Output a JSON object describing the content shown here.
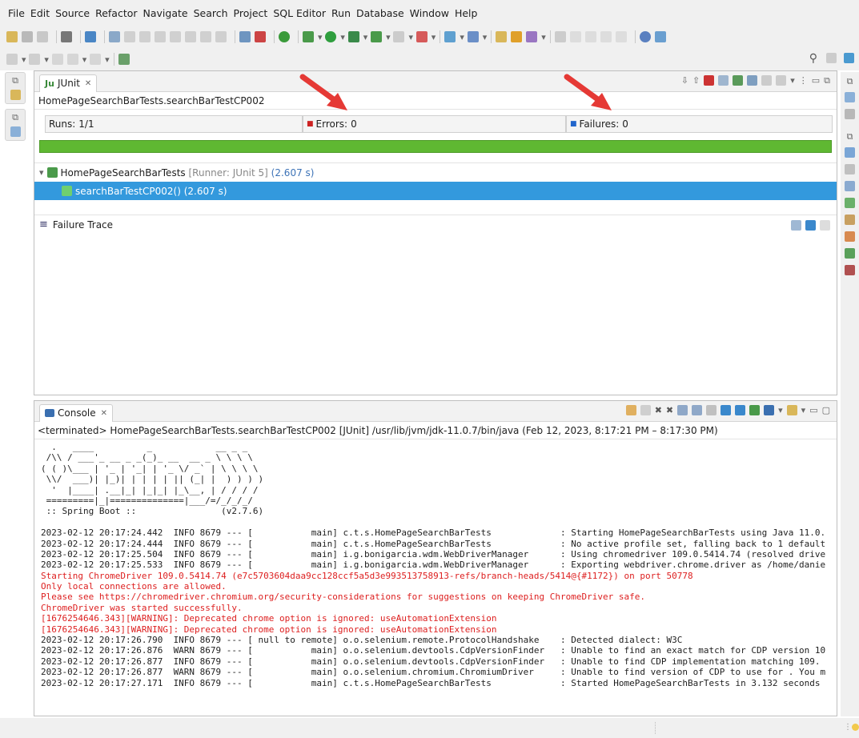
{
  "menu": [
    "File",
    "Edit",
    "Source",
    "Refactor",
    "Navigate",
    "Search",
    "Project",
    "SQL Editor",
    "Run",
    "Database",
    "Window",
    "Help"
  ],
  "junit": {
    "tab_label": "JUnit",
    "test_name": "HomePageSearchBarTests.searchBarTestCP002",
    "runs_label": "Runs:",
    "runs_value": "1/1",
    "errors_label": "Errors:",
    "errors_value": "0",
    "failures_label": "Failures:",
    "failures_value": "0",
    "progress_status_color": "#5fb832",
    "tree_root_name": "HomePageSearchBarTests",
    "tree_root_runner": "[Runner: JUnit 5]",
    "tree_root_time": "(2.607 s)",
    "tree_child_name": "searchBarTestCP002()",
    "tree_child_time": "(2.607 s)",
    "failure_trace_label": "Failure Trace"
  },
  "console": {
    "tab_label": "Console",
    "header": "<terminated> HomePageSearchBarTests.searchBarTestCP002 [JUnit] /usr/lib/jvm/jdk-11.0.7/bin/java (Feb 12, 2023, 8:17:21 PM – 8:17:30 PM)",
    "lines": [
      {
        "t": "  .   ____          _            __ _ _",
        "c": "normal"
      },
      {
        "t": " /\\\\ / ___'_ __ _ _(_)_ __  __ _ \\ \\ \\ \\",
        "c": "normal"
      },
      {
        "t": "( ( )\\___ | '_ | '_| | '_ \\/ _` | \\ \\ \\ \\",
        "c": "normal"
      },
      {
        "t": " \\\\/  ___)| |_)| | | | | || (_| |  ) ) ) )",
        "c": "normal"
      },
      {
        "t": "  '  |____| .__|_| |_|_| |_\\__, | / / / /",
        "c": "normal"
      },
      {
        "t": " =========|_|==============|___/=/_/_/_/",
        "c": "normal"
      },
      {
        "t": " :: Spring Boot ::                (v2.7.6)",
        "c": "normal"
      },
      {
        "t": "",
        "c": "normal"
      },
      {
        "t": "2023-02-12 20:17:24.442  INFO 8679 --- [           main] c.t.s.HomePageSearchBarTests             : Starting HomePageSearchBarTests using Java 11.0.",
        "c": "normal"
      },
      {
        "t": "2023-02-12 20:17:24.444  INFO 8679 --- [           main] c.t.s.HomePageSearchBarTests             : No active profile set, falling back to 1 default",
        "c": "normal"
      },
      {
        "t": "2023-02-12 20:17:25.504  INFO 8679 --- [           main] i.g.bonigarcia.wdm.WebDriverManager      : Using chromedriver 109.0.5414.74 (resolved drive",
        "c": "normal"
      },
      {
        "t": "2023-02-12 20:17:25.533  INFO 8679 --- [           main] i.g.bonigarcia.wdm.WebDriverManager      : Exporting webdriver.chrome.driver as /home/danie",
        "c": "normal"
      },
      {
        "t": "Starting ChromeDriver 109.0.5414.74 (e7c5703604daa9cc128ccf5a5d3e993513758913-refs/branch-heads/5414@{#1172}) on port 50778",
        "c": "err"
      },
      {
        "t": "Only local connections are allowed.",
        "c": "err"
      },
      {
        "t": "Please see https://chromedriver.chromium.org/security-considerations for suggestions on keeping ChromeDriver safe.",
        "c": "err"
      },
      {
        "t": "ChromeDriver was started successfully.",
        "c": "err"
      },
      {
        "t": "[1676254646.343][WARNING]: Deprecated chrome option is ignored: useAutomationExtension",
        "c": "err"
      },
      {
        "t": "[1676254646.343][WARNING]: Deprecated chrome option is ignored: useAutomationExtension",
        "c": "err"
      },
      {
        "t": "2023-02-12 20:17:26.790  INFO 8679 --- [ null to remote] o.o.selenium.remote.ProtocolHandshake    : Detected dialect: W3C",
        "c": "normal"
      },
      {
        "t": "2023-02-12 20:17:26.876  WARN 8679 --- [           main] o.o.selenium.devtools.CdpVersionFinder   : Unable to find an exact match for CDP version 10",
        "c": "normal"
      },
      {
        "t": "2023-02-12 20:17:26.877  INFO 8679 --- [           main] o.o.selenium.devtools.CdpVersionFinder   : Unable to find CDP implementation matching 109.",
        "c": "normal"
      },
      {
        "t": "2023-02-12 20:17:26.877  WARN 8679 --- [           main] o.o.selenium.chromium.ChromiumDriver     : Unable to find version of CDP to use for . You m",
        "c": "normal"
      },
      {
        "t": "2023-02-12 20:17:27.171  INFO 8679 --- [           main] c.t.s.HomePageSearchBarTests             : Started HomePageSearchBarTests in 3.132 seconds",
        "c": "normal"
      }
    ]
  },
  "colors": {
    "selection": "#3399dd",
    "error_text": "#dd1f1f",
    "arrow": "#e53935"
  }
}
